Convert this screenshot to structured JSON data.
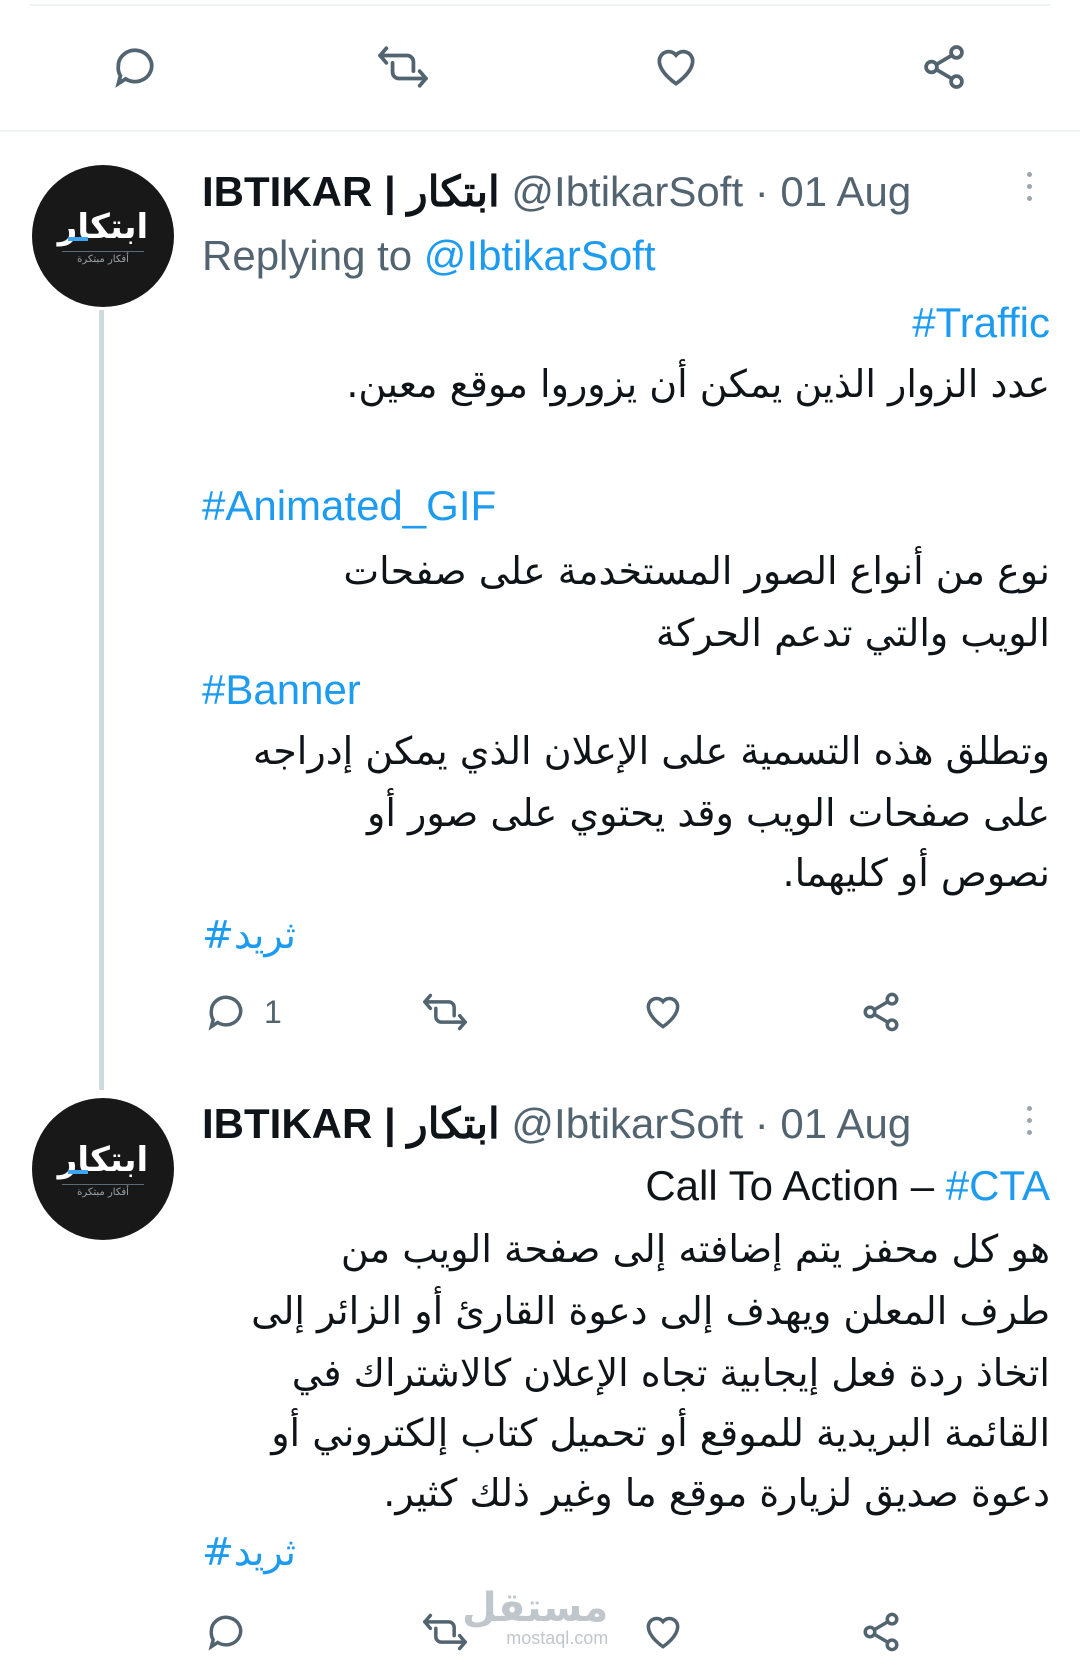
{
  "colors": {
    "accent": "#1d9bf0",
    "text": "#0f1419",
    "muted": "#536471",
    "divider": "#eff3f4"
  },
  "top_actions": {
    "icons": [
      "reply-icon",
      "retweet-icon",
      "like-icon",
      "share-icon"
    ]
  },
  "tweets": [
    {
      "author_name": "IBTIKAR | ابتكار",
      "handle_date": "@IbtikarSoft · 01 Aug",
      "replying_prefix": "Replying to ",
      "replying_handle": "@IbtikarSoft",
      "avatar_logo": "ابتكار",
      "avatar_tagline": "أفكار مبتكرة",
      "body": {
        "tag_traffic": "#Traffic",
        "text_traffic": "عدد الزوار الذين يمكن أن يزوروا موقع معين.",
        "tag_gif": "#Animated_GIF",
        "text_gif_1": "نوع من أنواع الصور المستخدمة على صفحات",
        "text_gif_2": "الويب والتي تدعم الحركة",
        "tag_banner": "#Banner",
        "text_banner_1": "وتطلق هذه التسمية على الإعلان الذي يمكن إدراجه",
        "text_banner_2": "على صفحات الويب وقد يحتوي على صور أو",
        "text_banner_3": "نصوص أو كليهما.",
        "tag_thread": "#ثريد"
      },
      "reply_count": "1"
    },
    {
      "author_name": "IBTIKAR | ابتكار",
      "handle_date": "@IbtikarSoft · 01 Aug",
      "avatar_logo": "ابتكار",
      "avatar_tagline": "أفكار مبتكرة",
      "body": {
        "cta_title": "Call To Action – ",
        "cta_tag": "#CTA",
        "line_1": "هو كل محفز يتم إضافته إلى صفحة الويب من",
        "line_2": "طرف المعلن ويهدف إلى دعوة القارئ أو الزائر إلى",
        "line_3": "اتخاذ ردة فعل إيجابية تجاه الإعلان كالاشتراك في",
        "line_4": "القائمة البريدية للموقع أو تحميل كتاب إلكتروني أو",
        "line_5": "دعوة صديق لزيارة موقع ما وغير ذلك كثير.",
        "tag_thread": "#ثريد"
      }
    }
  ],
  "watermark": {
    "arabic": "مستقل",
    "domain": "mostaql.com"
  }
}
